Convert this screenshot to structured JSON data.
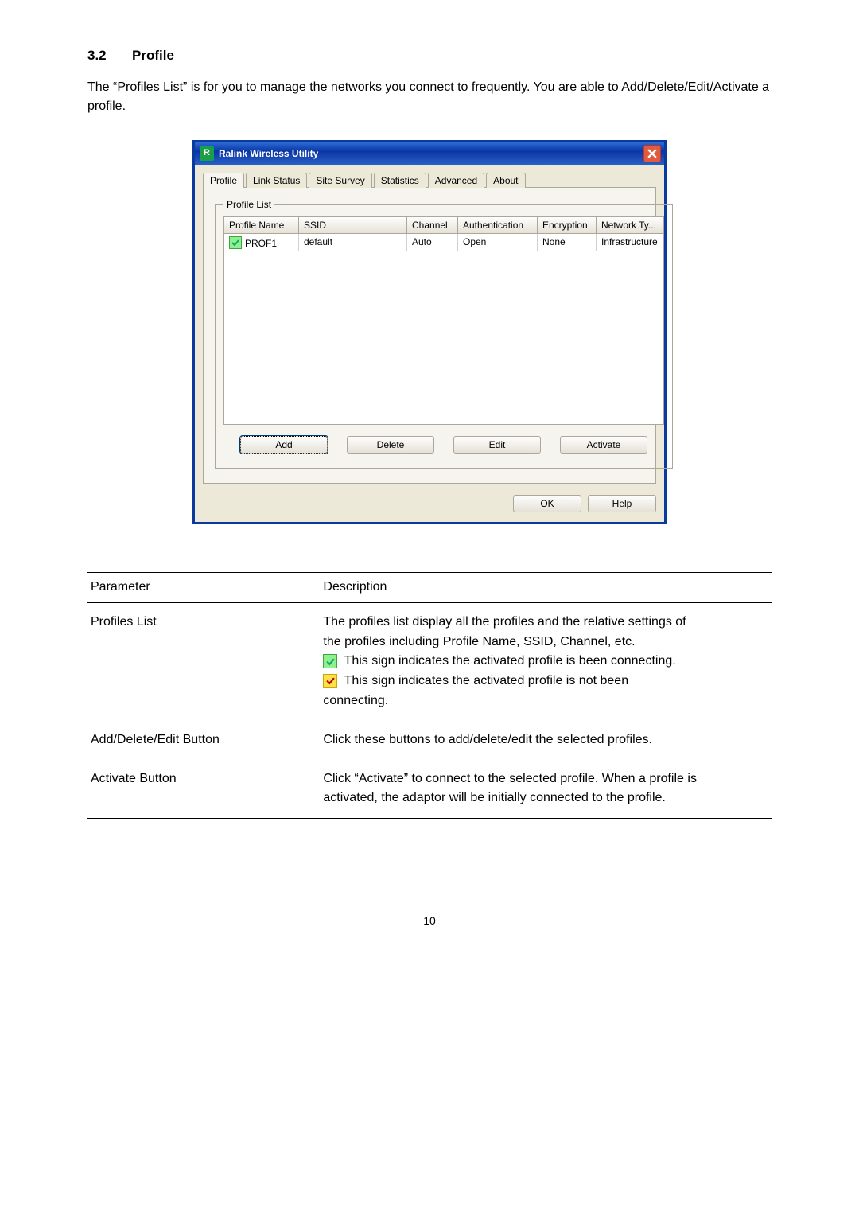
{
  "section": {
    "number": "3.2",
    "title": "Profile"
  },
  "intro": "The “Profiles List” is for you to manage the networks you connect to frequently. You are able to Add/Delete/Edit/Activate a profile.",
  "dialog": {
    "title": "Ralink Wireless Utility",
    "tabs": [
      "Profile",
      "Link Status",
      "Site Survey",
      "Statistics",
      "Advanced",
      "About"
    ],
    "profile_list_label": "Profile List",
    "columns": [
      "Profile Name",
      "SSID",
      "Channel",
      "Authentication",
      "Encryption",
      "Network Ty..."
    ],
    "row": {
      "profile_name": "PROF1",
      "ssid": "default",
      "channel": "Auto",
      "auth": "Open",
      "enc": "None",
      "net": "Infrastructure"
    },
    "buttons": {
      "add": "Add",
      "delete": "Delete",
      "edit": "Edit",
      "activate": "Activate"
    },
    "bottom": {
      "ok": "OK",
      "help": "Help"
    }
  },
  "table": {
    "h_param": "Parameter",
    "h_desc": "Description",
    "r1_param": "Profiles List",
    "r1_l1": "The profiles list display all the profiles and the relative settings of",
    "r1_l2": "the profiles including Profile Name, SSID, Channel, etc.",
    "r1_l3": "This sign indicates the activated profile is been connecting.",
    "r1_l4": "This sign indicates the activated profile is not been",
    "r1_l5": "connecting.",
    "r2_param": "Add/Delete/Edit Button",
    "r2_desc": "Click these buttons to add/delete/edit the selected profiles.",
    "r3_param": "Activate Button",
    "r3_l1": "Click “Activate” to connect to the selected profile. When a profile is",
    "r3_l2": "activated, the adaptor will be initially connected to the profile."
  },
  "page_number": "10"
}
